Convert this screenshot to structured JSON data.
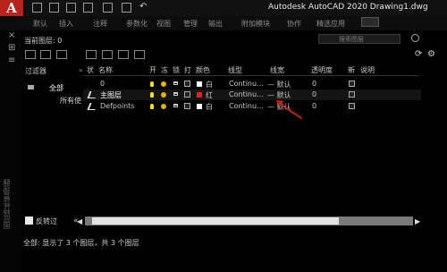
{
  "window": {
    "logo_letter": "A",
    "title": "Autodesk AutoCAD 2020    Drawing1.dwg"
  },
  "ribbon": {
    "tabs": [
      "默认",
      "插入",
      "注释",
      "参数化",
      "视图",
      "管理",
      "输出",
      "附加模块",
      "协作",
      "精选应用"
    ]
  },
  "palette": {
    "side_label": "图层特性管理器",
    "current_layer": "当前图层: 0",
    "search_placeholder": "搜索图层"
  },
  "filters": {
    "header": "过滤器",
    "all": "全部",
    "all_used": "所有使",
    "invert_label": "反转过",
    "collapse": "«"
  },
  "table": {
    "columns": [
      "状",
      "名称",
      "开",
      "冻",
      "锁",
      "打",
      "颜色",
      "线型",
      "线宽",
      "透明度",
      "新",
      "说明"
    ],
    "rows": [
      {
        "name": "0",
        "color_name": "白",
        "color_hex": "#ffffff",
        "linetype": "Continu...",
        "lineweight": "— 默认",
        "transparency": "0"
      },
      {
        "name": "主图层",
        "color_name": "红",
        "color_hex": "#e02020",
        "linetype": "Continu...",
        "lineweight": "— 默认",
        "transparency": "0"
      },
      {
        "name": "Defpoints",
        "color_name": "白",
        "color_hex": "#ffffff",
        "linetype": "Continu...",
        "lineweight": "— 默认",
        "transparency": "0"
      }
    ]
  },
  "status": {
    "line": "全部: 显示了 3 个图层，共 3 个图层"
  },
  "colors": {
    "accent_red": "#c0201e",
    "layer_red": "#e02020",
    "background": "#000000"
  }
}
